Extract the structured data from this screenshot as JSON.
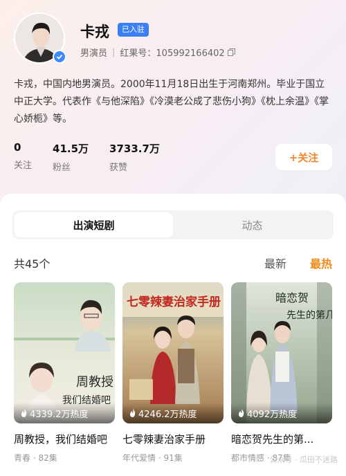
{
  "profile": {
    "name": "卡戎",
    "joined_badge": "已入驻",
    "role": "男演员",
    "id_label": "红果号：105992166402",
    "bio": "卡戎，中国内地男演员。2000年11月18日出生于河南郑州。毕业于国立中正大学。代表作《与他深陷》《冷漠老公成了悲伤小狗》《枕上余温》《掌心娇栀》等。",
    "stats": [
      {
        "value": "0",
        "label": "关注"
      },
      {
        "value": "41.5万",
        "label": "粉丝"
      },
      {
        "value": "3733.7万",
        "label": "获赞"
      }
    ],
    "follow_button": "+关注"
  },
  "tabs": [
    {
      "label": "出演短剧",
      "active": true
    },
    {
      "label": "动态",
      "active": false
    }
  ],
  "list": {
    "count_label": "共45个",
    "sort_options": [
      {
        "label": "最新",
        "active": false
      },
      {
        "label": "最热",
        "active": true
      }
    ],
    "cards": [
      {
        "heat": "4339.2万热度",
        "title": "周教授，我们结婚吧",
        "sub": "青春 · 82集",
        "poster_text": "周教授 我们结婚吧"
      },
      {
        "heat": "4246.2万热度",
        "title": "七零辣妻治家手册",
        "sub": "年代爱情 · 91集",
        "poster_text": "七零辣妻治家手册"
      },
      {
        "heat": "4092万热度",
        "title": "暗恋贺先生的第...",
        "sub": "都市情感 · 87集",
        "poster_text": "暗恋贺先生的第几年"
      }
    ]
  },
  "watermark": "公众号 · 瓜田不迷路",
  "colors": {
    "accent": "#f08a1d",
    "badge": "#3b7ff5"
  }
}
